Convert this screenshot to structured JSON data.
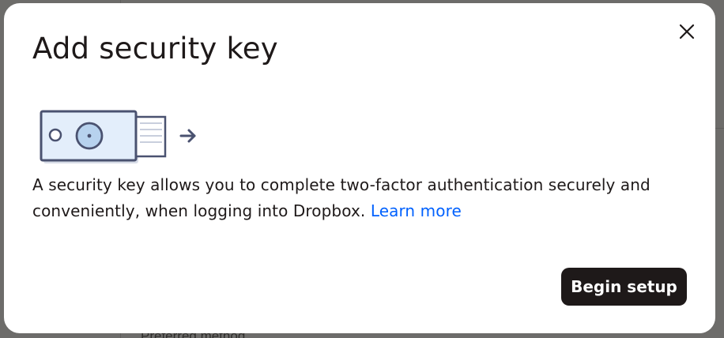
{
  "background": {
    "side_text": "",
    "bottom_text": "Preferred method"
  },
  "modal": {
    "title": "Add security key",
    "close_icon": "close-icon",
    "illustration_icon": "security-key-illustration",
    "description_text": "A security key allows you to complete two-factor authentication securely and conveniently, when logging into Dropbox.",
    "learn_more_label": "Learn more",
    "primary_button_label": "Begin setup"
  },
  "colors": {
    "overlay": "#6d6c6a",
    "modal_bg": "#ffffff",
    "text": "#1e1919",
    "link": "#0061fe",
    "button_bg": "#1e1919",
    "illustration_fill": "#e3eefb",
    "illustration_stroke": "#4a5270"
  }
}
